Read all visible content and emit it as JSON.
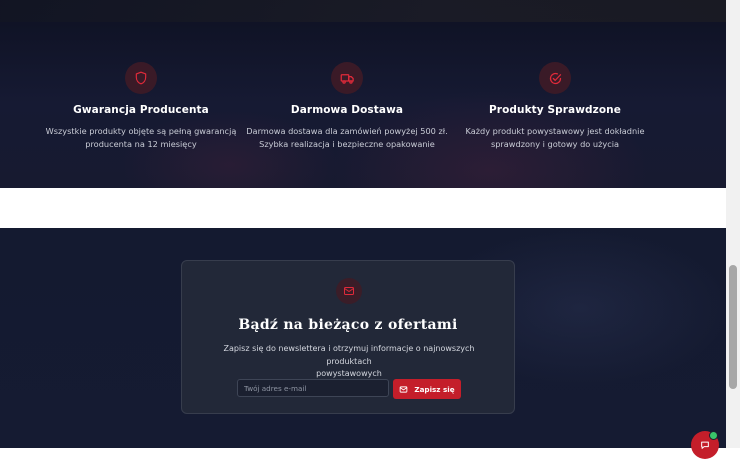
{
  "features": [
    {
      "icon": "shield-icon",
      "title": "Gwarancja Producenta",
      "desc_line1": "Wszystkie produkty objęte są pełną gwarancją",
      "desc_line2": "producenta na 12 miesięcy"
    },
    {
      "icon": "truck-icon",
      "title": "Darmowa Dostawa",
      "desc_line1": "Darmowa dostawa dla zamówień powyżej 500 zł.",
      "desc_line2": "Szybka realizacja i bezpieczne opakowanie"
    },
    {
      "icon": "check-badge-icon",
      "title": "Produkty Sprawdzone",
      "desc_line1": "Każdy produkt powystawowy jest dokładnie",
      "desc_line2": "sprawdzony i gotowy do użycia"
    }
  ],
  "newsletter": {
    "icon": "mail-icon",
    "title": "Bądź na bieżąco z ofertami",
    "subtitle_line1": "Zapisz się do newslettera i otrzymuj informacje o najnowszych produktach",
    "subtitle_line2": "powystawowych",
    "email_placeholder": "Twój adres e-mail",
    "email_value": "",
    "button_label": "Zapisz się",
    "button_icon": "mail-icon"
  },
  "chat": {
    "icon": "chat-icon",
    "status": "online"
  },
  "colors": {
    "accent": "#c41e2a",
    "icon_accent": "#e02a3a",
    "icon_bg": "#3a1a27",
    "dark_bg": "#151a30",
    "card_bg": "#222838",
    "online": "#39c46a"
  }
}
